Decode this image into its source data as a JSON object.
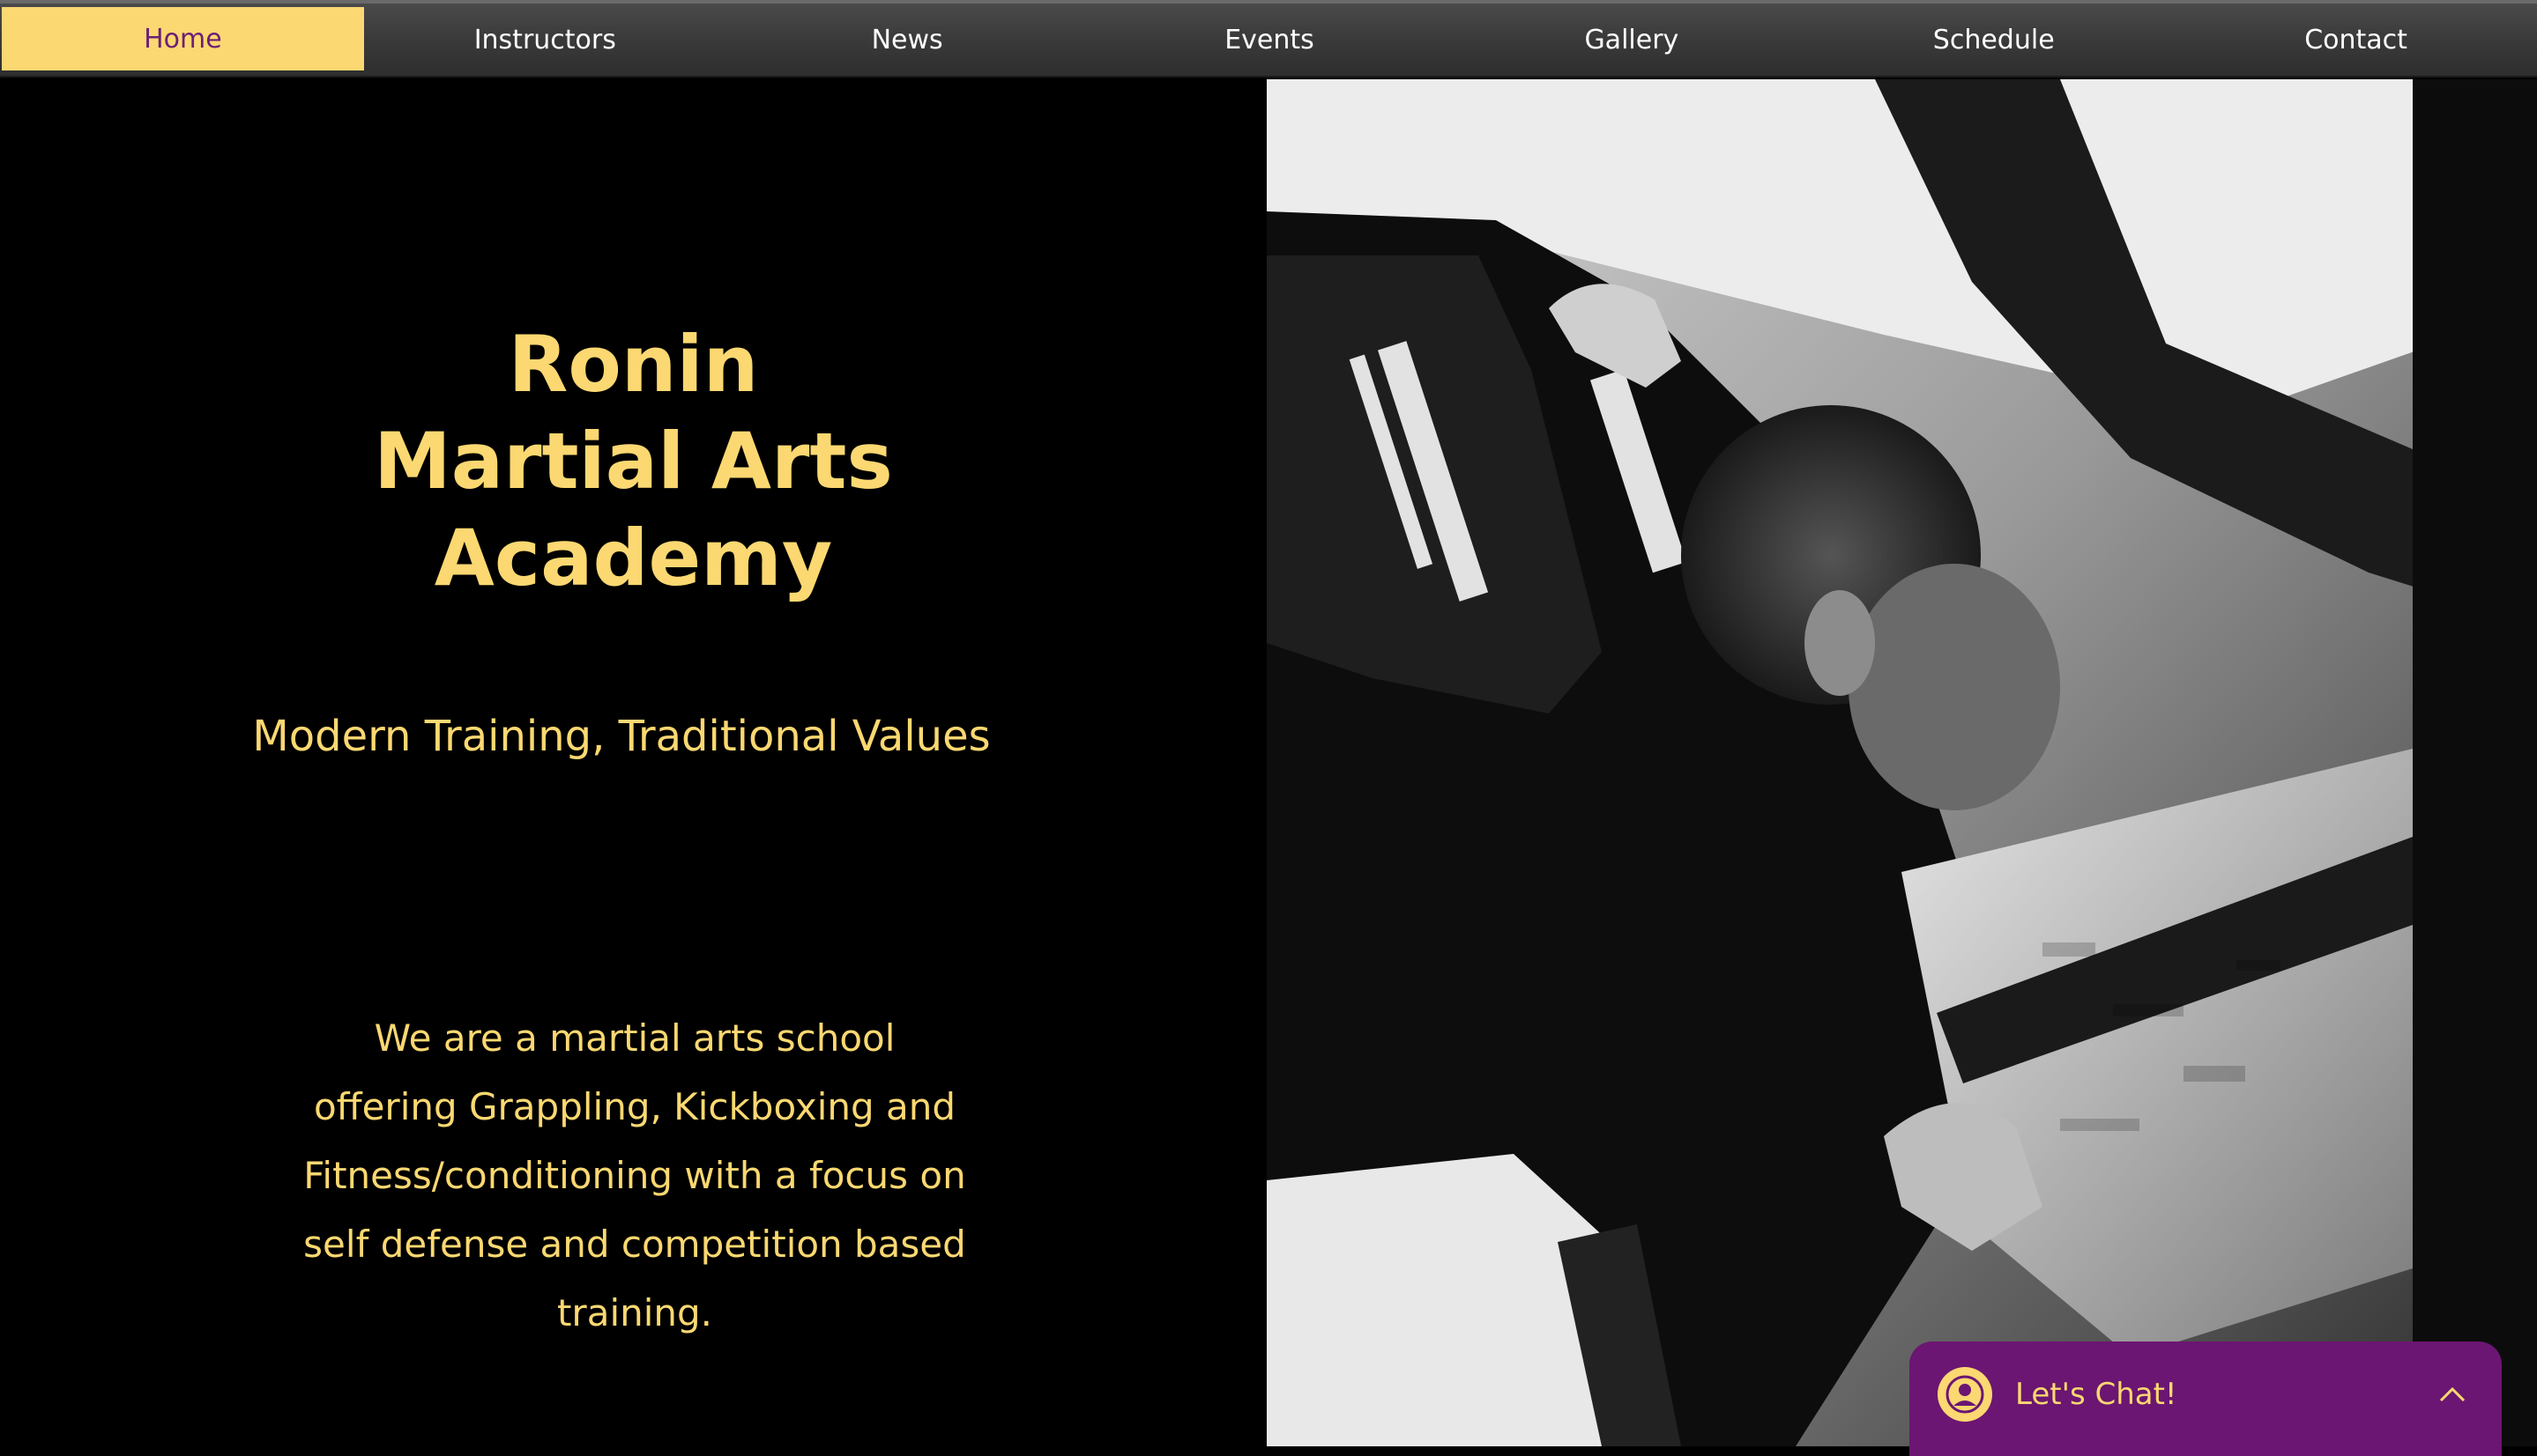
{
  "nav": {
    "items": [
      {
        "label": "Home",
        "active": true
      },
      {
        "label": "Instructors",
        "active": false
      },
      {
        "label": "News",
        "active": false
      },
      {
        "label": "Events",
        "active": false
      },
      {
        "label": "Gallery",
        "active": false
      },
      {
        "label": "Schedule",
        "active": false
      },
      {
        "label": "Contact",
        "active": false
      }
    ]
  },
  "hero": {
    "title_lines": [
      "Ronin",
      "Martial Arts",
      "Academy"
    ],
    "subtitle": "Modern Training, Traditional Values",
    "body": "We are a martial arts school offering Grappling, Kickboxing and Fitness/conditioning with a focus on self defense and competition based training.",
    "photo_icon": "grappling-photo"
  },
  "chat": {
    "label": "Let's Chat!",
    "avatar_icon": "user-avatar-icon",
    "toggle_icon": "chevron-up-icon"
  },
  "colors": {
    "accent": "#fbd871",
    "nav_bg": "#3c3c3c",
    "active_text": "#6c1f76",
    "chat_bg": "#6b1672",
    "page_bg": "#000000"
  }
}
